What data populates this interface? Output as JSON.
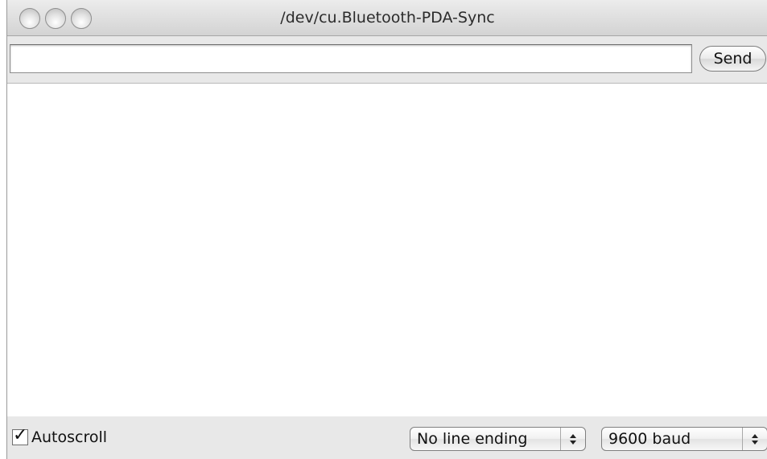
{
  "window": {
    "title": "/dev/cu.Bluetooth-PDA-Sync"
  },
  "input": {
    "value": "",
    "placeholder": "",
    "send_label": "Send"
  },
  "output": {
    "text": ""
  },
  "bottom": {
    "autoscroll_label": "Autoscroll",
    "autoscroll_checked": true,
    "line_ending": "No line ending",
    "baud": "9600 baud"
  },
  "icons": {
    "close": "close-button-icon",
    "minimize": "minimize-button-icon",
    "zoom": "zoom-button-icon",
    "checkmark": "checkmark-icon",
    "popup_arrows": "up-down-arrows-icon"
  }
}
